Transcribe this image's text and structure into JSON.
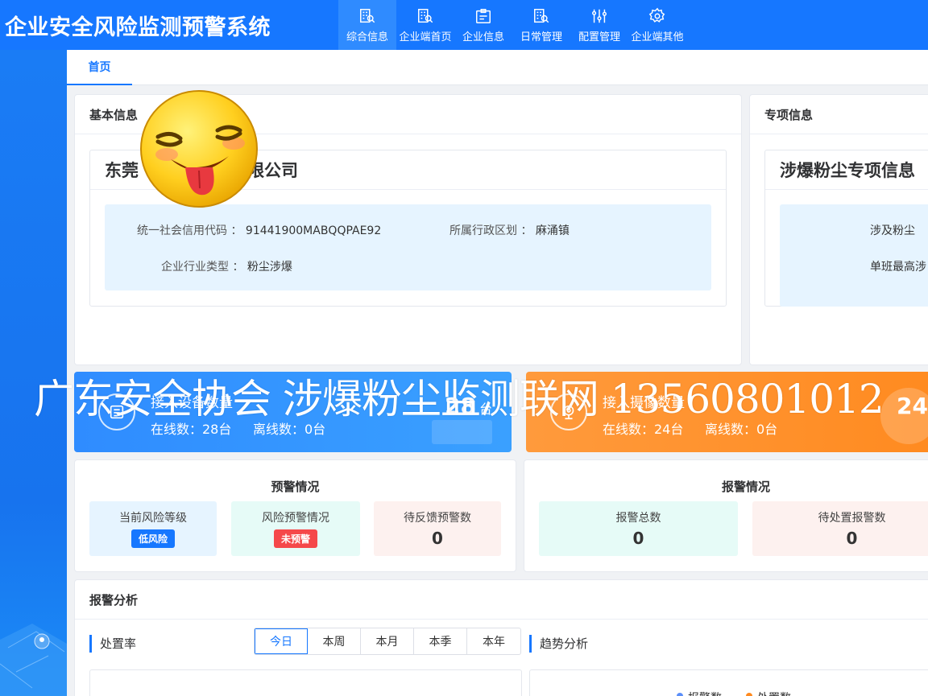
{
  "app": {
    "title": "企业安全风险监测预警系统"
  },
  "nav": [
    {
      "label": "综合信息",
      "icon": "building-search-icon",
      "active": true
    },
    {
      "label": "企业端首页",
      "icon": "building-search-icon"
    },
    {
      "label": "企业信息",
      "icon": "id-card-icon"
    },
    {
      "label": "日常管理",
      "icon": "building-search-icon"
    },
    {
      "label": "配置管理",
      "icon": "sliders-icon"
    },
    {
      "label": "企业端其他",
      "icon": "gear-icon"
    }
  ],
  "tabs": [
    {
      "label": "首页"
    }
  ],
  "basic_info": {
    "title": "基本信息",
    "company_name_left": "东莞",
    "company_name_right": "有限公司",
    "credit_code_label": "统一社会信用代码 ：",
    "credit_code_value": "91441900MABQQPAE92",
    "region_label": "所属行政区划 ：",
    "region_value": "麻涌镇",
    "industry_label": "企业行业类型 ：",
    "industry_value": "粉尘涉爆"
  },
  "special_info": {
    "title": "专项信息",
    "inner_title": "涉爆粉尘专项信息",
    "row1": "涉及粉尘",
    "row2": "单班最高涉"
  },
  "stats": {
    "left": {
      "title": "接入设备数量",
      "online": "在线数：28台",
      "offline": "离线数：0台",
      "number": "28",
      "unit": "台"
    },
    "right": {
      "title": "接入摄像数量",
      "online": "在线数：24台",
      "offline": "离线数：0台",
      "number": "24"
    }
  },
  "warning": {
    "title": "预警情况",
    "risk_level_label": "当前风险等级",
    "risk_level_badge": "低风险",
    "risk_warning_label": "风险预警情况",
    "risk_warning_badge": "未预警",
    "pending_feedback_label": "待反馈预警数",
    "pending_feedback_value": "0"
  },
  "alarm": {
    "title": "报警情况",
    "total_label": "报警总数",
    "total_value": "0",
    "pending_label": "待处置报警数",
    "pending_value": "0"
  },
  "analysis": {
    "title": "报警分析",
    "rate_label": "处置率",
    "trend_label": "趋势分析",
    "periods": [
      "今日",
      "本周",
      "本月",
      "本季",
      "本年"
    ],
    "legend_alarm": "报警数",
    "legend_handled": "处置数"
  },
  "watermark": "广东安全协会 涉爆粉尘监测联网 13560801012",
  "colors": {
    "primary": "#1677ff",
    "low_risk": "#1677ff",
    "no_warning": "#f5484a",
    "orange": "#ff8a1f"
  }
}
